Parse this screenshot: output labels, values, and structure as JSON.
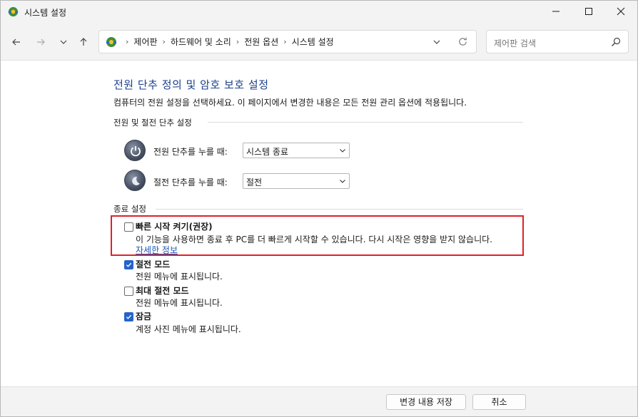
{
  "window": {
    "title": "시스템 설정"
  },
  "nav": {
    "breadcrumbs": [
      "제어판",
      "하드웨어 및 소리",
      "전원 옵션",
      "시스템 설정"
    ],
    "breadcrumb_separator": "›",
    "search_placeholder": "제어판 검색"
  },
  "main": {
    "title": "전원 단추 정의 및 암호 보호 설정",
    "description": "컴퓨터의 전원 설정을 선택하세요. 이 페이지에서 변경한 내용은 모든 전원 관리 옵션에 적용됩니다.",
    "power_section": {
      "label": "전원 및 절전 단추 설정",
      "rows": [
        {
          "label": "전원 단추를 누를 때:",
          "value": "시스템 종료",
          "icon": "power-button-icon"
        },
        {
          "label": "절전 단추를 누를 때:",
          "value": "절전",
          "icon": "sleep-button-icon"
        }
      ]
    },
    "shutdown_section": {
      "label": "종료 설정",
      "options": [
        {
          "title": "빠른 시작 켜기(권장)",
          "checked": false,
          "description": "이 기능을 사용하면 종료 후 PC를 더 빠르게 시작할 수 있습니다. 다시 시작은 영향을 받지 않습니다.",
          "link": "자세한 정보"
        },
        {
          "title": "절전 모드",
          "checked": true,
          "description": "전원 메뉴에 표시됩니다."
        },
        {
          "title": "최대 절전 모드",
          "checked": false,
          "description": "전원 메뉴에 표시됩니다."
        },
        {
          "title": "잠금",
          "checked": true,
          "description": "계정 사진 메뉴에 표시됩니다."
        }
      ]
    }
  },
  "footer": {
    "save_label": "변경 내용 저장",
    "cancel_label": "취소"
  },
  "colors": {
    "accent": "#2563c9",
    "title_blue": "#1b3f8b",
    "link_blue": "#1b56b8",
    "highlight_red": "#e0202a"
  }
}
